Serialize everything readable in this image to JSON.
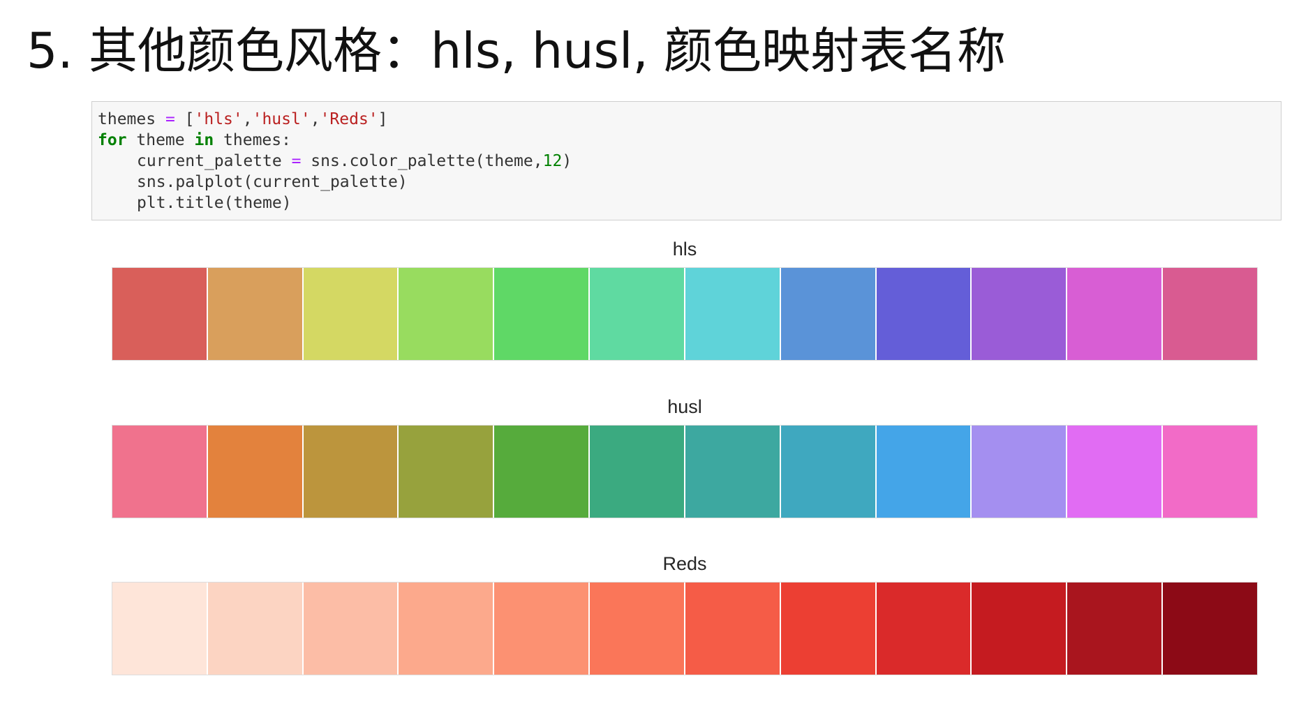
{
  "title": "5. 其他颜色风格：hls, husl, 颜色映射表名称",
  "code": {
    "line1": {
      "var": "themes",
      "eq": " = ",
      "open": "[",
      "s1": "'hls'",
      "c1": ",",
      "s2": "'husl'",
      "c2": ",",
      "s3": "'Reds'",
      "close": "]"
    },
    "line2": {
      "kw_for": "for",
      "mid": " theme ",
      "kw_in": "in",
      "rest": " themes:"
    },
    "line3": {
      "lhs": "current_palette",
      "eq": " = ",
      "call": "sns.color_palette(theme,",
      "num": "12",
      "close": ")"
    },
    "line4": {
      "text": "sns.palplot(current_palette)"
    },
    "line5": {
      "text": "plt.title(theme)"
    }
  },
  "palettes": [
    {
      "title": "hls",
      "colors": [
        "#d95f5a",
        "#d99f5c",
        "#d4d863",
        "#98dc5f",
        "#5fd866",
        "#5fdaa1",
        "#5fd3d9",
        "#5a93d8",
        "#645ed8",
        "#9a5cd7",
        "#d85ed4",
        "#d95b91"
      ]
    },
    {
      "title": "husl",
      "colors": [
        "#f0728d",
        "#e3823d",
        "#bc953d",
        "#97a23d",
        "#56ab3c",
        "#3baa80",
        "#3da8a0",
        "#3fa8bf",
        "#44a5e8",
        "#a48ff0",
        "#e16cf3",
        "#f26bc7"
      ]
    },
    {
      "title": "Reds",
      "colors": [
        "#fee5d9",
        "#fcd4c2",
        "#fcbda6",
        "#fca98c",
        "#fc9172",
        "#fa7659",
        "#f55c47",
        "#ec3f33",
        "#da2a2a",
        "#c51b20",
        "#a9151e",
        "#8c0a16"
      ]
    }
  ]
}
